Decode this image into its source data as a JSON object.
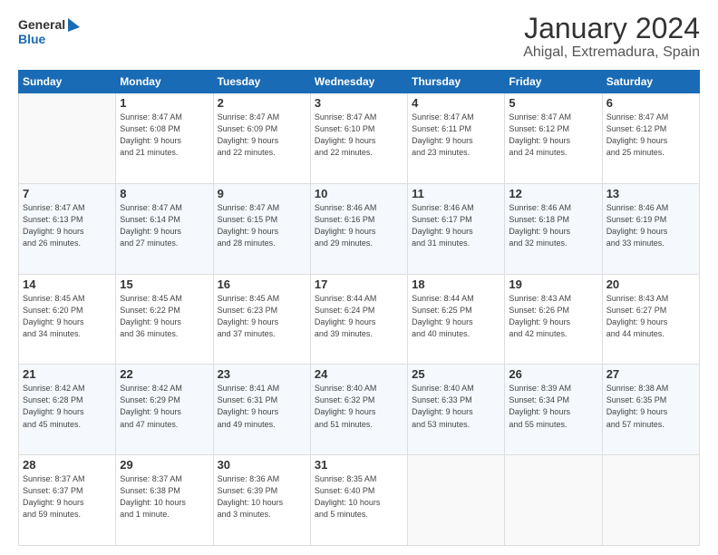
{
  "logo": {
    "text_general": "General",
    "text_blue": "Blue"
  },
  "header": {
    "month_year": "January 2024",
    "location": "Ahigal, Extremadura, Spain"
  },
  "weekdays": [
    "Sunday",
    "Monday",
    "Tuesday",
    "Wednesday",
    "Thursday",
    "Friday",
    "Saturday"
  ],
  "weeks": [
    [
      {
        "day": "",
        "sunrise": "",
        "sunset": "",
        "daylight": ""
      },
      {
        "day": "1",
        "sunrise": "Sunrise: 8:47 AM",
        "sunset": "Sunset: 6:08 PM",
        "daylight": "Daylight: 9 hours and 21 minutes."
      },
      {
        "day": "2",
        "sunrise": "Sunrise: 8:47 AM",
        "sunset": "Sunset: 6:09 PM",
        "daylight": "Daylight: 9 hours and 22 minutes."
      },
      {
        "day": "3",
        "sunrise": "Sunrise: 8:47 AM",
        "sunset": "Sunset: 6:10 PM",
        "daylight": "Daylight: 9 hours and 22 minutes."
      },
      {
        "day": "4",
        "sunrise": "Sunrise: 8:47 AM",
        "sunset": "Sunset: 6:11 PM",
        "daylight": "Daylight: 9 hours and 23 minutes."
      },
      {
        "day": "5",
        "sunrise": "Sunrise: 8:47 AM",
        "sunset": "Sunset: 6:12 PM",
        "daylight": "Daylight: 9 hours and 24 minutes."
      },
      {
        "day": "6",
        "sunrise": "Sunrise: 8:47 AM",
        "sunset": "Sunset: 6:12 PM",
        "daylight": "Daylight: 9 hours and 25 minutes."
      }
    ],
    [
      {
        "day": "7",
        "sunrise": "Sunrise: 8:47 AM",
        "sunset": "Sunset: 6:13 PM",
        "daylight": "Daylight: 9 hours and 26 minutes."
      },
      {
        "day": "8",
        "sunrise": "Sunrise: 8:47 AM",
        "sunset": "Sunset: 6:14 PM",
        "daylight": "Daylight: 9 hours and 27 minutes."
      },
      {
        "day": "9",
        "sunrise": "Sunrise: 8:47 AM",
        "sunset": "Sunset: 6:15 PM",
        "daylight": "Daylight: 9 hours and 28 minutes."
      },
      {
        "day": "10",
        "sunrise": "Sunrise: 8:46 AM",
        "sunset": "Sunset: 6:16 PM",
        "daylight": "Daylight: 9 hours and 29 minutes."
      },
      {
        "day": "11",
        "sunrise": "Sunrise: 8:46 AM",
        "sunset": "Sunset: 6:17 PM",
        "daylight": "Daylight: 9 hours and 31 minutes."
      },
      {
        "day": "12",
        "sunrise": "Sunrise: 8:46 AM",
        "sunset": "Sunset: 6:18 PM",
        "daylight": "Daylight: 9 hours and 32 minutes."
      },
      {
        "day": "13",
        "sunrise": "Sunrise: 8:46 AM",
        "sunset": "Sunset: 6:19 PM",
        "daylight": "Daylight: 9 hours and 33 minutes."
      }
    ],
    [
      {
        "day": "14",
        "sunrise": "Sunrise: 8:45 AM",
        "sunset": "Sunset: 6:20 PM",
        "daylight": "Daylight: 9 hours and 34 minutes."
      },
      {
        "day": "15",
        "sunrise": "Sunrise: 8:45 AM",
        "sunset": "Sunset: 6:22 PM",
        "daylight": "Daylight: 9 hours and 36 minutes."
      },
      {
        "day": "16",
        "sunrise": "Sunrise: 8:45 AM",
        "sunset": "Sunset: 6:23 PM",
        "daylight": "Daylight: 9 hours and 37 minutes."
      },
      {
        "day": "17",
        "sunrise": "Sunrise: 8:44 AM",
        "sunset": "Sunset: 6:24 PM",
        "daylight": "Daylight: 9 hours and 39 minutes."
      },
      {
        "day": "18",
        "sunrise": "Sunrise: 8:44 AM",
        "sunset": "Sunset: 6:25 PM",
        "daylight": "Daylight: 9 hours and 40 minutes."
      },
      {
        "day": "19",
        "sunrise": "Sunrise: 8:43 AM",
        "sunset": "Sunset: 6:26 PM",
        "daylight": "Daylight: 9 hours and 42 minutes."
      },
      {
        "day": "20",
        "sunrise": "Sunrise: 8:43 AM",
        "sunset": "Sunset: 6:27 PM",
        "daylight": "Daylight: 9 hours and 44 minutes."
      }
    ],
    [
      {
        "day": "21",
        "sunrise": "Sunrise: 8:42 AM",
        "sunset": "Sunset: 6:28 PM",
        "daylight": "Daylight: 9 hours and 45 minutes."
      },
      {
        "day": "22",
        "sunrise": "Sunrise: 8:42 AM",
        "sunset": "Sunset: 6:29 PM",
        "daylight": "Daylight: 9 hours and 47 minutes."
      },
      {
        "day": "23",
        "sunrise": "Sunrise: 8:41 AM",
        "sunset": "Sunset: 6:31 PM",
        "daylight": "Daylight: 9 hours and 49 minutes."
      },
      {
        "day": "24",
        "sunrise": "Sunrise: 8:40 AM",
        "sunset": "Sunset: 6:32 PM",
        "daylight": "Daylight: 9 hours and 51 minutes."
      },
      {
        "day": "25",
        "sunrise": "Sunrise: 8:40 AM",
        "sunset": "Sunset: 6:33 PM",
        "daylight": "Daylight: 9 hours and 53 minutes."
      },
      {
        "day": "26",
        "sunrise": "Sunrise: 8:39 AM",
        "sunset": "Sunset: 6:34 PM",
        "daylight": "Daylight: 9 hours and 55 minutes."
      },
      {
        "day": "27",
        "sunrise": "Sunrise: 8:38 AM",
        "sunset": "Sunset: 6:35 PM",
        "daylight": "Daylight: 9 hours and 57 minutes."
      }
    ],
    [
      {
        "day": "28",
        "sunrise": "Sunrise: 8:37 AM",
        "sunset": "Sunset: 6:37 PM",
        "daylight": "Daylight: 9 hours and 59 minutes."
      },
      {
        "day": "29",
        "sunrise": "Sunrise: 8:37 AM",
        "sunset": "Sunset: 6:38 PM",
        "daylight": "Daylight: 10 hours and 1 minute."
      },
      {
        "day": "30",
        "sunrise": "Sunrise: 8:36 AM",
        "sunset": "Sunset: 6:39 PM",
        "daylight": "Daylight: 10 hours and 3 minutes."
      },
      {
        "day": "31",
        "sunrise": "Sunrise: 8:35 AM",
        "sunset": "Sunset: 6:40 PM",
        "daylight": "Daylight: 10 hours and 5 minutes."
      },
      {
        "day": "",
        "sunrise": "",
        "sunset": "",
        "daylight": ""
      },
      {
        "day": "",
        "sunrise": "",
        "sunset": "",
        "daylight": ""
      },
      {
        "day": "",
        "sunrise": "",
        "sunset": "",
        "daylight": ""
      }
    ]
  ]
}
